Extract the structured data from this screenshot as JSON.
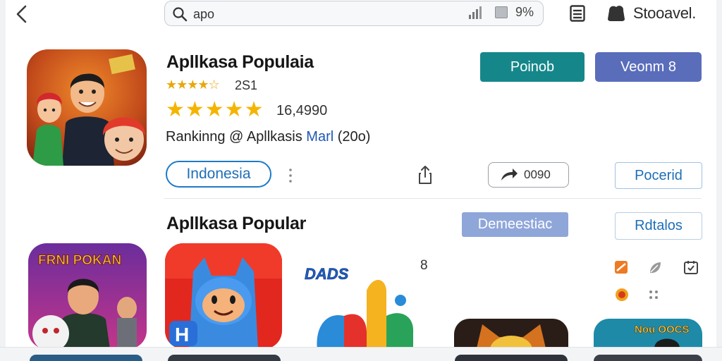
{
  "topbar": {
    "back_icon": "chevron-left-icon",
    "search_value": "apo",
    "battery_text": "9%",
    "store_label": "Stooavel."
  },
  "hero": {
    "title": "Apllkasa Populaia",
    "rating_small_stars": "★★★★☆",
    "rating_small_value": "2S1",
    "rating_big_stars": "★★★★★",
    "rating_big_value": "16,4990",
    "ranking_prefix": "Rankinng @ Apllkasis ",
    "ranking_highlight": "Marl",
    "ranking_suffix": " (20o)",
    "btn_primary": "Poinob",
    "btn_secondary": "Veonm 8",
    "chip_region": "Indonesia",
    "share_count": "0090",
    "btn_outline": "Pocerid"
  },
  "section2": {
    "title": "Apllkasa Popular",
    "btn_filled": "Demeestiac",
    "btn_outline": "Rdtalos",
    "count_badge": "8",
    "app1_caption": "FRNI POKAN",
    "app3_caption": "DADS",
    "app5_caption": "Nou OOCS"
  },
  "colors": {
    "teal": "#15878a",
    "purple": "#5a6dbb",
    "light_blue": "#8fa6d9",
    "link_blue": "#1e6fb7",
    "star_yellow": "#f5b400"
  }
}
